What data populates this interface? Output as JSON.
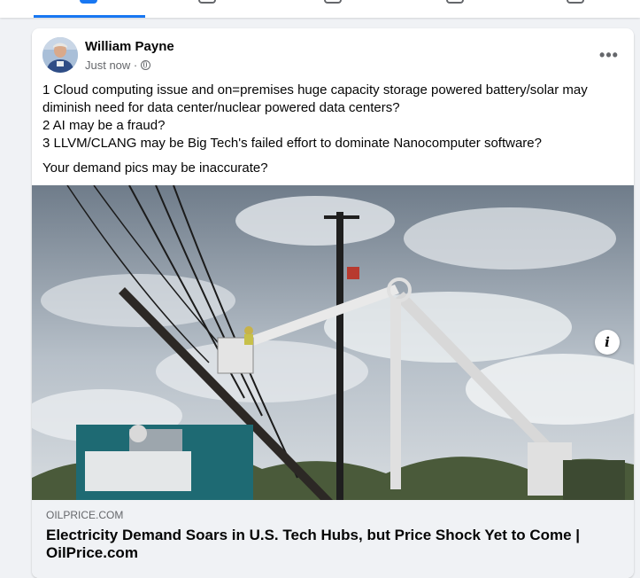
{
  "nav": {
    "tabs": [
      {
        "icon": "home-icon",
        "active": true
      },
      {
        "icon": "video-icon",
        "active": false
      },
      {
        "icon": "marketplace-icon",
        "active": false
      },
      {
        "icon": "groups-icon",
        "active": false
      },
      {
        "icon": "gaming-icon",
        "active": false
      }
    ]
  },
  "post": {
    "author": "William Payne",
    "timestamp": "Just now ·",
    "privacy_icon": "globe-icon",
    "more_label": "•••",
    "lines": [
      "1 Cloud computing issue and on=premises huge capacity storage powered   battery/solar may diminish need for data center/nuclear powered data centers?",
      "2 AI may be a fraud?",
      "3 LLVM/CLANG may be Big Tech's failed effort to dominate Nanocomputer software?"
    ],
    "closing": "Your demand pics may be inaccurate?",
    "info_label": "i",
    "link": {
      "domain": "OILPRICE.COM",
      "title": "Electricity Demand Soars in U.S. Tech Hubs, but Price Shock Yet to Come | OilPrice.com"
    }
  },
  "colors": {
    "accent": "#1877f2",
    "background": "#f0f2f5",
    "secondary_text": "#65676b"
  }
}
